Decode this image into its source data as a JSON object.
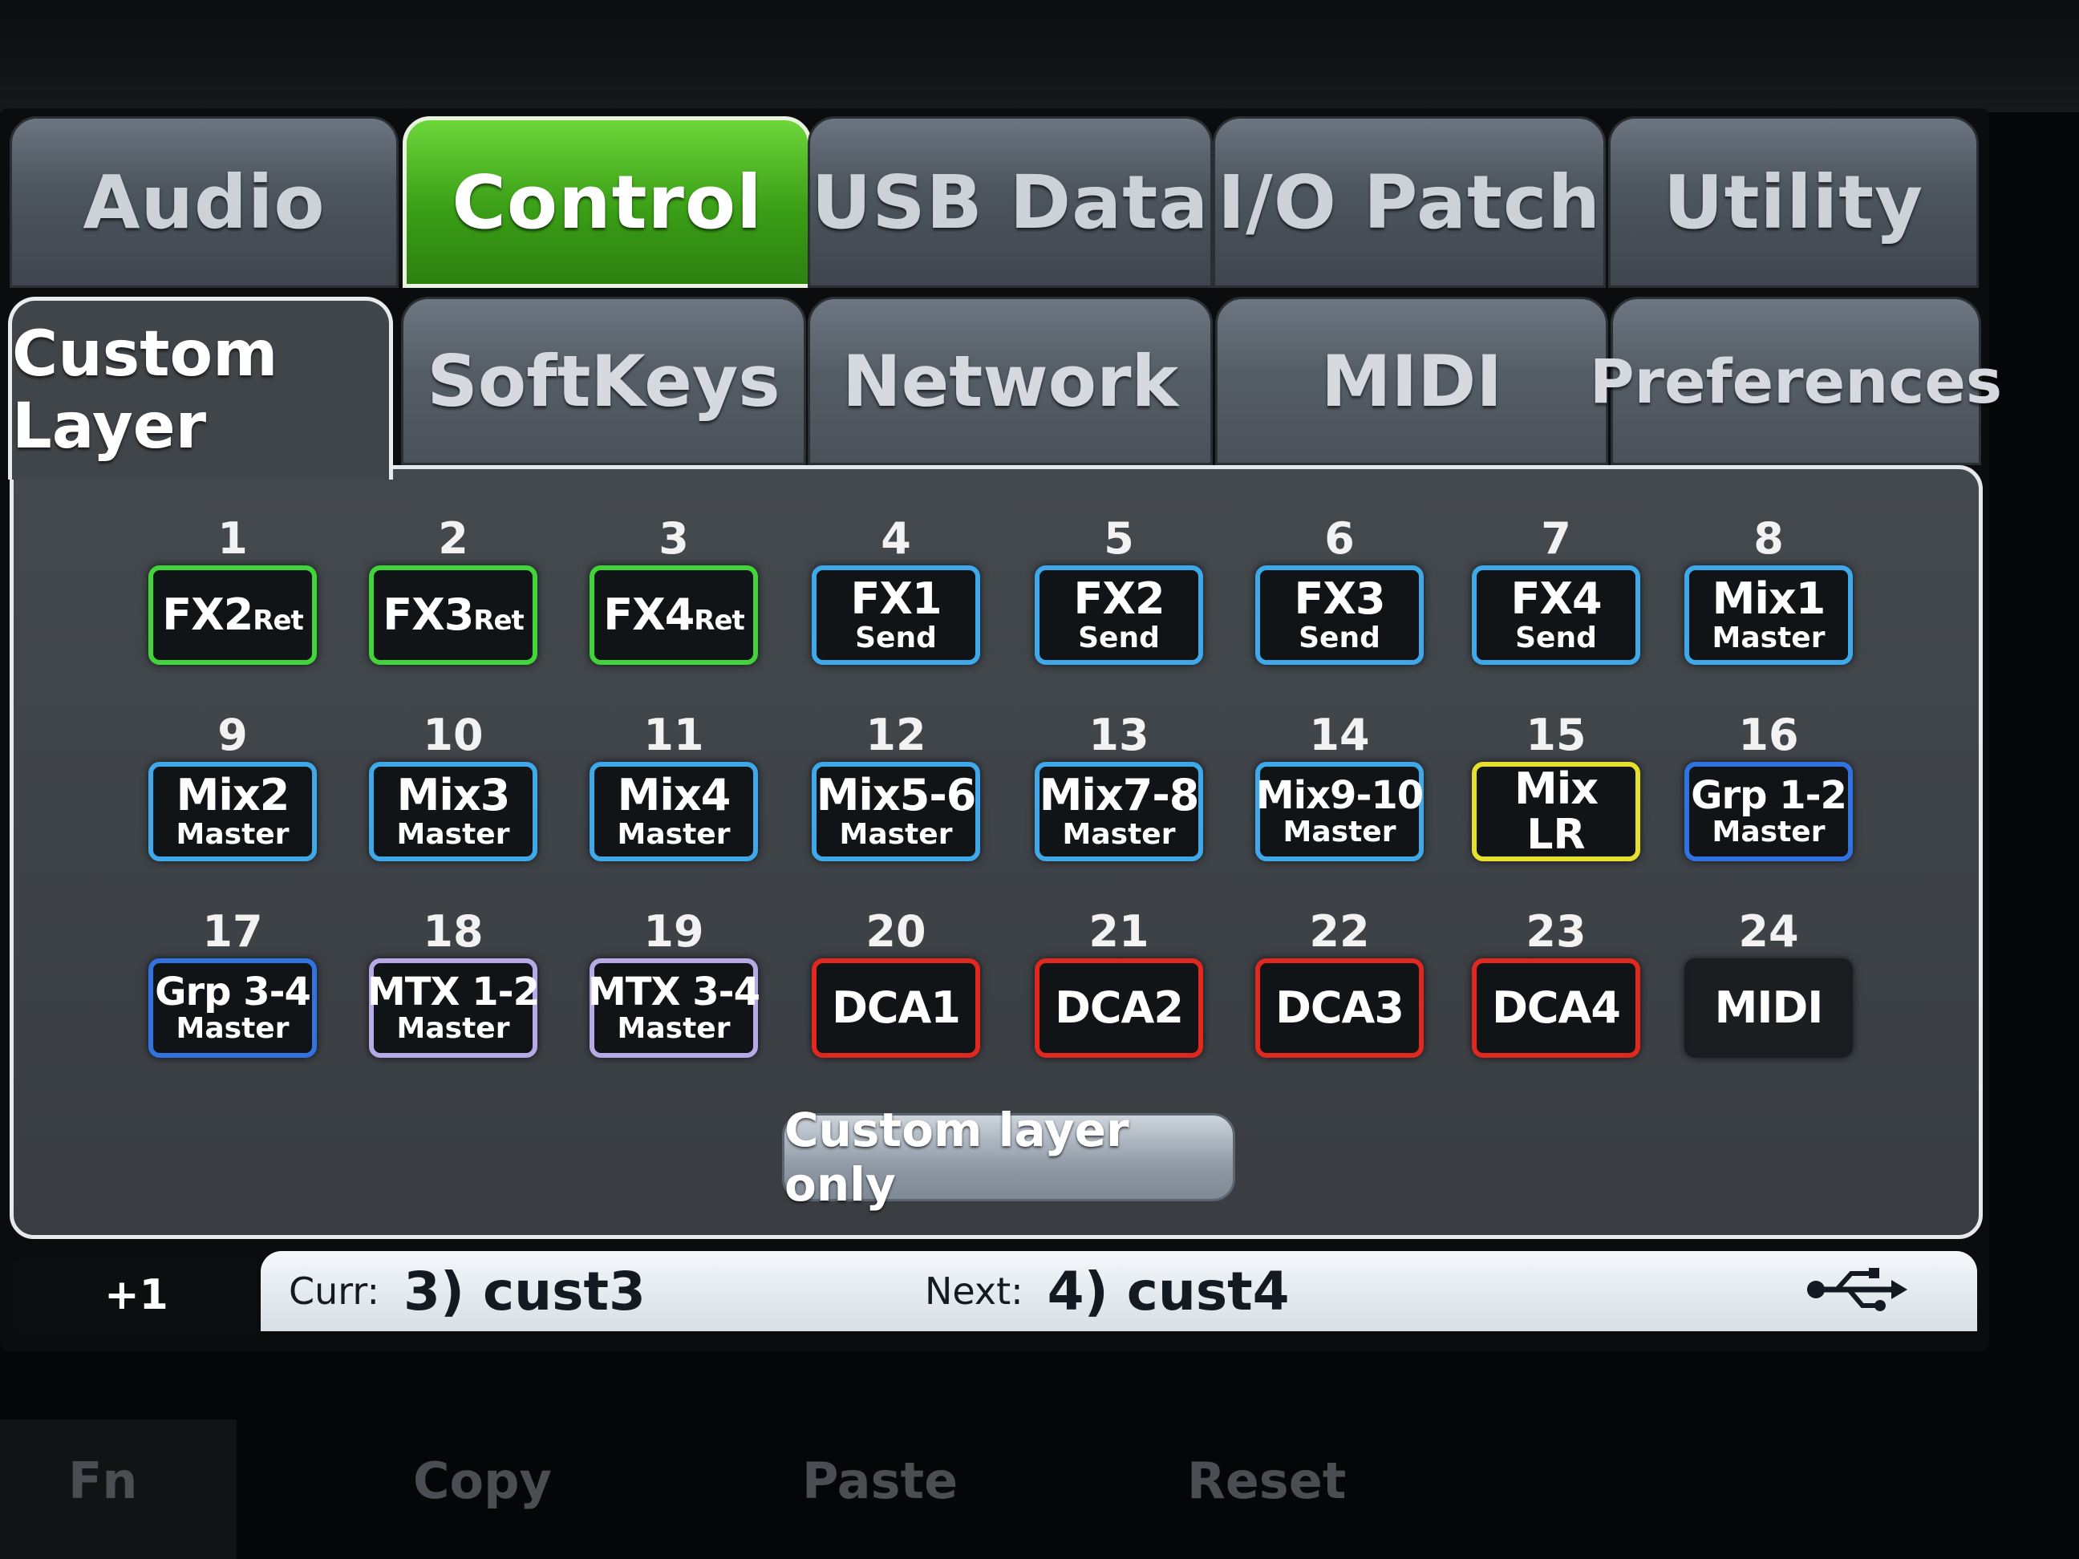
{
  "top_tabs": [
    "Audio",
    "Control",
    "USB Data",
    "I/O Patch",
    "Utility"
  ],
  "active_top_tab": "Control",
  "sub_tabs": [
    "Custom Layer",
    "SoftKeys",
    "Network",
    "MIDI",
    "Preferences"
  ],
  "active_sub_tab": "Custom Layer",
  "slots": [
    {
      "num": "1",
      "main": "FX2",
      "suffix": "Ret",
      "sub": "",
      "color": "#42d53a"
    },
    {
      "num": "2",
      "main": "FX3",
      "suffix": "Ret",
      "sub": "",
      "color": "#42d53a"
    },
    {
      "num": "3",
      "main": "FX4",
      "suffix": "Ret",
      "sub": "",
      "color": "#42d53a"
    },
    {
      "num": "4",
      "main": "FX1",
      "suffix": "",
      "sub": "Send",
      "color": "#3fa8e8"
    },
    {
      "num": "5",
      "main": "FX2",
      "suffix": "",
      "sub": "Send",
      "color": "#3fa8e8"
    },
    {
      "num": "6",
      "main": "FX3",
      "suffix": "",
      "sub": "Send",
      "color": "#3fa8e8"
    },
    {
      "num": "7",
      "main": "FX4",
      "suffix": "",
      "sub": "Send",
      "color": "#3fa8e8"
    },
    {
      "num": "8",
      "main": "Mix1",
      "suffix": "",
      "sub": "Master",
      "color": "#3fa8e8"
    },
    {
      "num": "9",
      "main": "Mix2",
      "suffix": "",
      "sub": "Master",
      "color": "#3fa8e8"
    },
    {
      "num": "10",
      "main": "Mix3",
      "suffix": "",
      "sub": "Master",
      "color": "#3fa8e8"
    },
    {
      "num": "11",
      "main": "Mix4",
      "suffix": "",
      "sub": "Master",
      "color": "#3fa8e8"
    },
    {
      "num": "12",
      "main": "Mix5-6",
      "suffix": "",
      "sub": "Master",
      "color": "#3fa8e8"
    },
    {
      "num": "13",
      "main": "Mix7-8",
      "suffix": "",
      "sub": "Master",
      "color": "#3fa8e8"
    },
    {
      "num": "14",
      "main": "Mix9-10",
      "suffix": "",
      "sub": "Master",
      "color": "#3fa8e8"
    },
    {
      "num": "15",
      "main": "Mix",
      "suffix": "",
      "sub": "LR",
      "color": "#e6e02c"
    },
    {
      "num": "16",
      "main": "Grp 1-2",
      "suffix": "",
      "sub": "Master",
      "color": "#2f72e0"
    },
    {
      "num": "17",
      "main": "Grp 3-4",
      "suffix": "",
      "sub": "Master",
      "color": "#2f72e0"
    },
    {
      "num": "18",
      "main": "MTX 1-2",
      "suffix": "",
      "sub": "Master",
      "color": "#b7a8e6"
    },
    {
      "num": "19",
      "main": "MTX 3-4",
      "suffix": "",
      "sub": "Master",
      "color": "#b7a8e6"
    },
    {
      "num": "20",
      "main": "DCA1",
      "suffix": "",
      "sub": "",
      "color": "#e0281f"
    },
    {
      "num": "21",
      "main": "DCA2",
      "suffix": "",
      "sub": "",
      "color": "#e0281f"
    },
    {
      "num": "22",
      "main": "DCA3",
      "suffix": "",
      "sub": "",
      "color": "#e0281f"
    },
    {
      "num": "23",
      "main": "DCA4",
      "suffix": "",
      "sub": "",
      "color": "#e0281f"
    },
    {
      "num": "24",
      "main": "MIDI",
      "suffix": "",
      "sub": "",
      "color": "#1a1c1f"
    }
  ],
  "custom_layer_button": "Custom layer only",
  "status": {
    "offset": "+1",
    "curr_label": "Curr:",
    "curr_value": "3) cust3",
    "next_label": "Next:",
    "next_value": "4) cust4",
    "usb_icon": "usb-icon"
  },
  "hardware_buttons": [
    "Fn",
    "Copy",
    "Paste",
    "Reset"
  ]
}
